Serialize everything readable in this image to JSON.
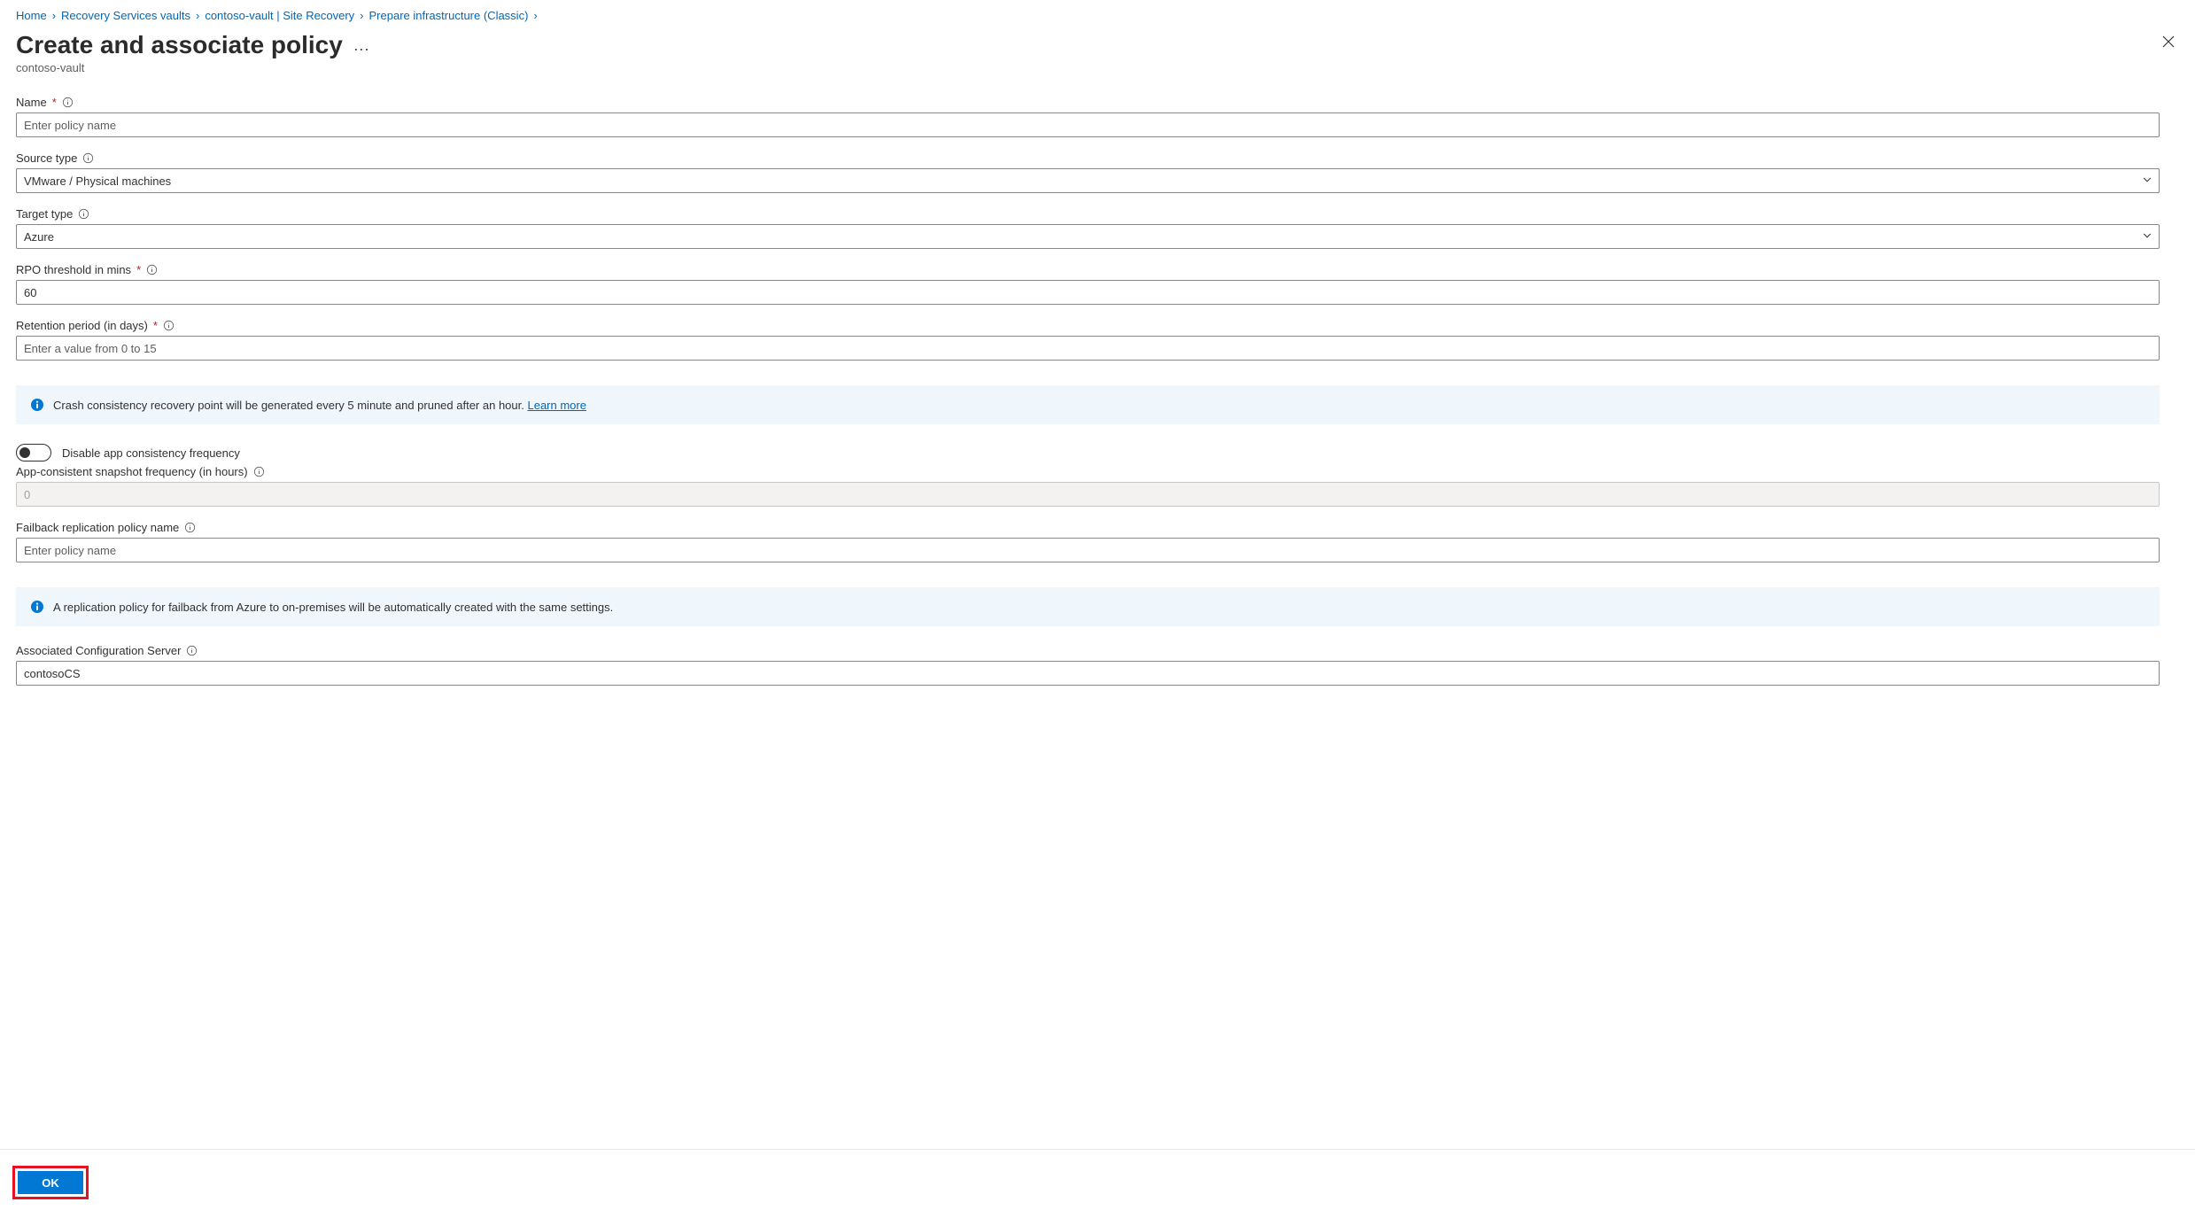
{
  "breadcrumbs": {
    "home": "Home",
    "vaults": "Recovery Services vaults",
    "vault_instance": "contoso-vault | Site Recovery",
    "prepare": "Prepare infrastructure (Classic)"
  },
  "header": {
    "title": "Create and associate policy",
    "subtitle": "contoso-vault"
  },
  "fields": {
    "name": {
      "label": "Name",
      "placeholder": "Enter policy name",
      "value": ""
    },
    "source_type": {
      "label": "Source type",
      "value": "VMware / Physical machines"
    },
    "target_type": {
      "label": "Target type",
      "value": "Azure"
    },
    "rpo": {
      "label": "RPO threshold in mins",
      "value": "60"
    },
    "retention": {
      "label": "Retention period (in days)",
      "placeholder": "Enter a value from 0 to 15",
      "value": ""
    },
    "disable_app_consistency_label": "Disable app consistency frequency",
    "app_snapshot": {
      "label": "App-consistent snapshot frequency (in hours)",
      "value": "0"
    },
    "failback_name": {
      "label": "Failback replication policy name",
      "placeholder": "Enter policy name",
      "value": ""
    },
    "associated_server": {
      "label": "Associated Configuration Server",
      "value": "contosoCS"
    }
  },
  "info": {
    "crash_consistency_text": "Crash consistency recovery point will be generated every 5 minute and pruned after an hour. ",
    "learn_more": "Learn more",
    "failback_text": "A replication policy for failback from Azure to on-premises will be automatically created with the same settings."
  },
  "footer": {
    "ok": "OK"
  }
}
